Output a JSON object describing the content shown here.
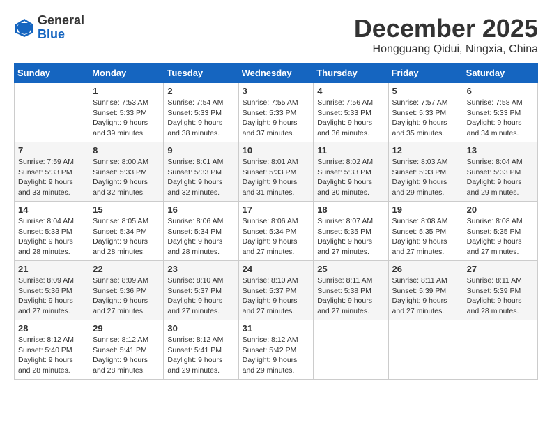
{
  "logo": {
    "general": "General",
    "blue": "Blue"
  },
  "title": "December 2025",
  "location": "Hongguang Qidui, Ningxia, China",
  "days_of_week": [
    "Sunday",
    "Monday",
    "Tuesday",
    "Wednesday",
    "Thursday",
    "Friday",
    "Saturday"
  ],
  "weeks": [
    [
      {
        "day": "",
        "info": ""
      },
      {
        "day": "1",
        "info": "Sunrise: 7:53 AM\nSunset: 5:33 PM\nDaylight: 9 hours\nand 39 minutes."
      },
      {
        "day": "2",
        "info": "Sunrise: 7:54 AM\nSunset: 5:33 PM\nDaylight: 9 hours\nand 38 minutes."
      },
      {
        "day": "3",
        "info": "Sunrise: 7:55 AM\nSunset: 5:33 PM\nDaylight: 9 hours\nand 37 minutes."
      },
      {
        "day": "4",
        "info": "Sunrise: 7:56 AM\nSunset: 5:33 PM\nDaylight: 9 hours\nand 36 minutes."
      },
      {
        "day": "5",
        "info": "Sunrise: 7:57 AM\nSunset: 5:33 PM\nDaylight: 9 hours\nand 35 minutes."
      },
      {
        "day": "6",
        "info": "Sunrise: 7:58 AM\nSunset: 5:33 PM\nDaylight: 9 hours\nand 34 minutes."
      }
    ],
    [
      {
        "day": "7",
        "info": "Sunrise: 7:59 AM\nSunset: 5:33 PM\nDaylight: 9 hours\nand 33 minutes."
      },
      {
        "day": "8",
        "info": "Sunrise: 8:00 AM\nSunset: 5:33 PM\nDaylight: 9 hours\nand 32 minutes."
      },
      {
        "day": "9",
        "info": "Sunrise: 8:01 AM\nSunset: 5:33 PM\nDaylight: 9 hours\nand 32 minutes."
      },
      {
        "day": "10",
        "info": "Sunrise: 8:01 AM\nSunset: 5:33 PM\nDaylight: 9 hours\nand 31 minutes."
      },
      {
        "day": "11",
        "info": "Sunrise: 8:02 AM\nSunset: 5:33 PM\nDaylight: 9 hours\nand 30 minutes."
      },
      {
        "day": "12",
        "info": "Sunrise: 8:03 AM\nSunset: 5:33 PM\nDaylight: 9 hours\nand 29 minutes."
      },
      {
        "day": "13",
        "info": "Sunrise: 8:04 AM\nSunset: 5:33 PM\nDaylight: 9 hours\nand 29 minutes."
      }
    ],
    [
      {
        "day": "14",
        "info": "Sunrise: 8:04 AM\nSunset: 5:33 PM\nDaylight: 9 hours\nand 28 minutes."
      },
      {
        "day": "15",
        "info": "Sunrise: 8:05 AM\nSunset: 5:34 PM\nDaylight: 9 hours\nand 28 minutes."
      },
      {
        "day": "16",
        "info": "Sunrise: 8:06 AM\nSunset: 5:34 PM\nDaylight: 9 hours\nand 28 minutes."
      },
      {
        "day": "17",
        "info": "Sunrise: 8:06 AM\nSunset: 5:34 PM\nDaylight: 9 hours\nand 27 minutes."
      },
      {
        "day": "18",
        "info": "Sunrise: 8:07 AM\nSunset: 5:35 PM\nDaylight: 9 hours\nand 27 minutes."
      },
      {
        "day": "19",
        "info": "Sunrise: 8:08 AM\nSunset: 5:35 PM\nDaylight: 9 hours\nand 27 minutes."
      },
      {
        "day": "20",
        "info": "Sunrise: 8:08 AM\nSunset: 5:35 PM\nDaylight: 9 hours\nand 27 minutes."
      }
    ],
    [
      {
        "day": "21",
        "info": "Sunrise: 8:09 AM\nSunset: 5:36 PM\nDaylight: 9 hours\nand 27 minutes."
      },
      {
        "day": "22",
        "info": "Sunrise: 8:09 AM\nSunset: 5:36 PM\nDaylight: 9 hours\nand 27 minutes."
      },
      {
        "day": "23",
        "info": "Sunrise: 8:10 AM\nSunset: 5:37 PM\nDaylight: 9 hours\nand 27 minutes."
      },
      {
        "day": "24",
        "info": "Sunrise: 8:10 AM\nSunset: 5:37 PM\nDaylight: 9 hours\nand 27 minutes."
      },
      {
        "day": "25",
        "info": "Sunrise: 8:11 AM\nSunset: 5:38 PM\nDaylight: 9 hours\nand 27 minutes."
      },
      {
        "day": "26",
        "info": "Sunrise: 8:11 AM\nSunset: 5:39 PM\nDaylight: 9 hours\nand 27 minutes."
      },
      {
        "day": "27",
        "info": "Sunrise: 8:11 AM\nSunset: 5:39 PM\nDaylight: 9 hours\nand 28 minutes."
      }
    ],
    [
      {
        "day": "28",
        "info": "Sunrise: 8:12 AM\nSunset: 5:40 PM\nDaylight: 9 hours\nand 28 minutes."
      },
      {
        "day": "29",
        "info": "Sunrise: 8:12 AM\nSunset: 5:41 PM\nDaylight: 9 hours\nand 28 minutes."
      },
      {
        "day": "30",
        "info": "Sunrise: 8:12 AM\nSunset: 5:41 PM\nDaylight: 9 hours\nand 29 minutes."
      },
      {
        "day": "31",
        "info": "Sunrise: 8:12 AM\nSunset: 5:42 PM\nDaylight: 9 hours\nand 29 minutes."
      },
      {
        "day": "",
        "info": ""
      },
      {
        "day": "",
        "info": ""
      },
      {
        "day": "",
        "info": ""
      }
    ]
  ]
}
